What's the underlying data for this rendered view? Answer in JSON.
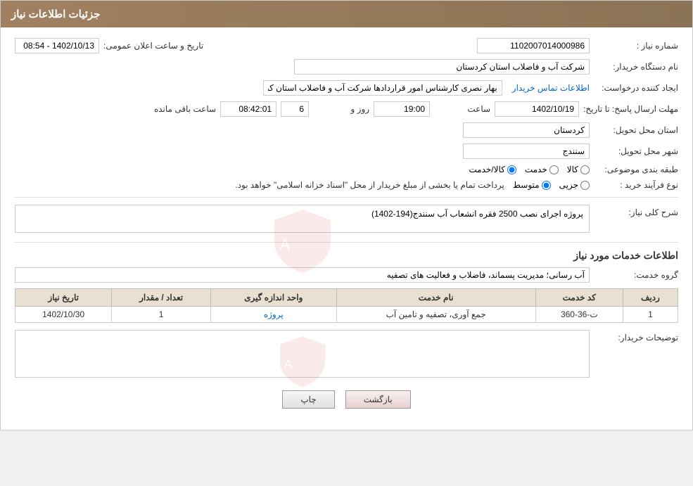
{
  "header": {
    "title": "جزئیات اطلاعات نیاز"
  },
  "fields": {
    "need_number_label": "شماره نیاز :",
    "need_number_value": "1102007014000986",
    "announcement_date_label": "تاریخ و ساعت اعلان عمومی:",
    "announcement_date_value": "1402/10/13 - 08:54",
    "buyer_org_label": "نام دستگاه خریدار:",
    "buyer_org_value": "شرکت آب و فاضلاب استان کردستان",
    "creator_label": "ایجاد کننده درخواست:",
    "creator_name": "بهار نصری کارشناس امور قراردادها شرکت آب و فاضلاب استان کردستان",
    "creator_link": "اطلاعات تماس خریدار",
    "deadline_label": "مهلت ارسال پاسخ: تا تاریخ:",
    "deadline_date": "1402/10/19",
    "deadline_time_label": "ساعت",
    "deadline_time": "19:00",
    "deadline_days_label": "روز و",
    "deadline_days": "6",
    "deadline_remaining_label": "ساعت باقی مانده",
    "deadline_remaining": "08:42:01",
    "province_label": "استان محل تحویل:",
    "province_value": "کردستان",
    "city_label": "شهر محل تحویل:",
    "city_value": "سنندج",
    "category_label": "طبقه بندی موضوعی:",
    "category_kala": "کالا",
    "category_khadamat": "خدمت",
    "category_kala_khadamat": "کالا/خدمت",
    "purchase_type_label": "نوع فرآیند خرید :",
    "purchase_type_jozvi": "جزیی",
    "purchase_type_motevaset": "متوسط",
    "purchase_note": "پرداخت تمام یا بخشی از مبلغ خریدار از محل \"اسناد خزانه اسلامی\" خواهد بود.",
    "need_description_label": "شرح کلی نیاز:",
    "need_description_value": "پروژه اجرای نصب 2500 فقره انشعاب آب سنندج(194-1402)",
    "services_title": "اطلاعات خدمات مورد نیاز",
    "service_group_label": "گروه خدمت:",
    "service_group_value": "آب رسانی؛ مدیریت پسماند، فاضلاب و فعالیت های تصفیه",
    "table_headers": [
      "ردیف",
      "کد خدمت",
      "نام خدمت",
      "واحد اندازه گیری",
      "تعداد / مقدار",
      "تاریخ نیاز"
    ],
    "table_rows": [
      {
        "row": "1",
        "code": "ت-36-360",
        "name": "جمع آوری، تصفیه و تامین آب",
        "unit": "پروژه",
        "quantity": "1",
        "date": "1402/10/30"
      }
    ],
    "buyer_desc_label": "توضیحات خریدار:",
    "buyer_desc_value": ""
  },
  "buttons": {
    "back_label": "بازگشت",
    "print_label": "چاپ"
  }
}
